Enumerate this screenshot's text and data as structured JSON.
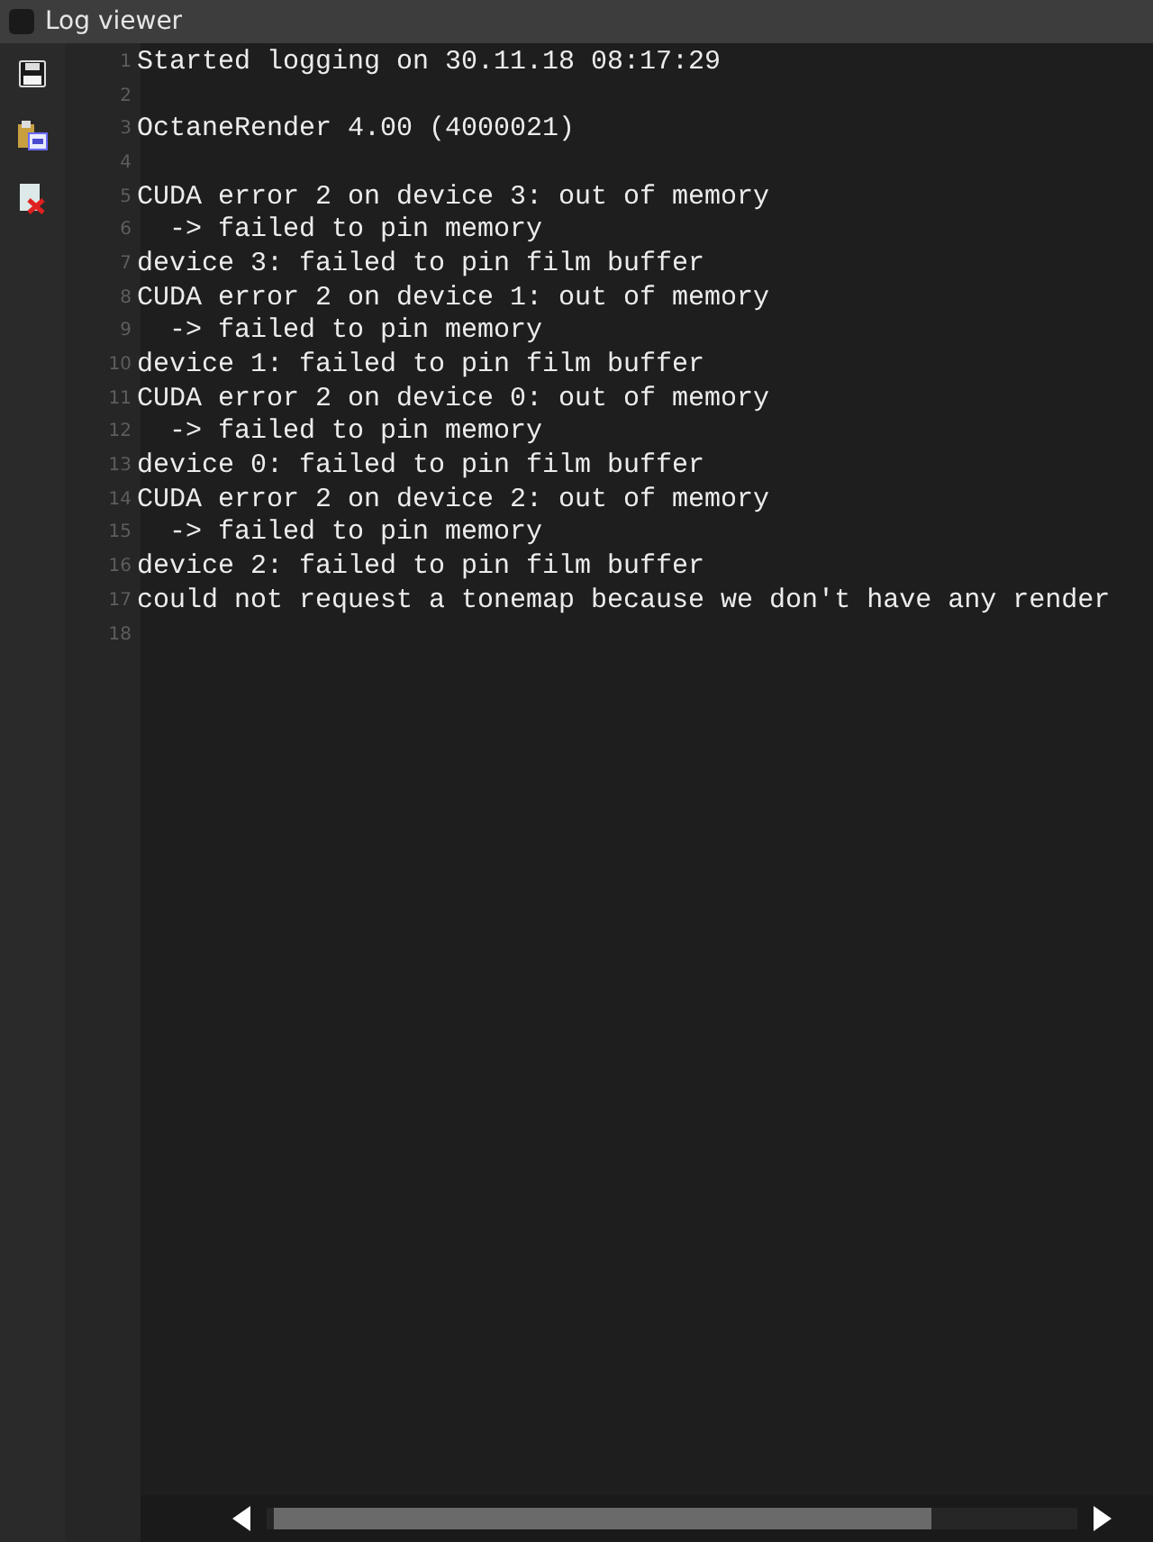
{
  "window": {
    "title": "Log viewer"
  },
  "lines": [
    {
      "number": "1",
      "text": "Started logging on 30.11.18 08:17:29"
    },
    {
      "number": "2"
    },
    {
      "number": "3",
      "text": "OctaneRender 4.00 (4000021)"
    },
    {
      "number": "4"
    },
    {
      "number": "5",
      "text": "CUDA error 2 on device 3: out of memory"
    },
    {
      "number": "6",
      "text": "  -> failed to pin memory"
    },
    {
      "number": "7",
      "text": "device 3: failed to pin film buffer"
    },
    {
      "number": "8",
      "text": "CUDA error 2 on device 1: out of memory"
    },
    {
      "number": "9",
      "text": "  -> failed to pin memory"
    },
    {
      "number": "10",
      "text": "device 1: failed to pin film buffer"
    },
    {
      "number": "11",
      "text": "CUDA error 2 on device 0: out of memory"
    },
    {
      "number": "12",
      "text": "  -> failed to pin memory"
    },
    {
      "number": "13",
      "text": "device 0: failed to pin film buffer"
    },
    {
      "number": "14",
      "text": "CUDA error 2 on device 2: out of memory"
    },
    {
      "number": "15",
      "text": "  -> failed to pin memory"
    },
    {
      "number": "16",
      "text": "device 2: failed to pin film buffer"
    },
    {
      "number": "17",
      "text": "could not request a tonemap because we don't have any render"
    },
    {
      "number": "18"
    }
  ]
}
